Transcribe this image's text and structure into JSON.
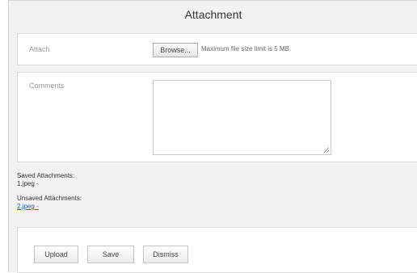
{
  "dialog": {
    "title": "Attachment"
  },
  "attach": {
    "label": "Attach",
    "browse_label": "Browse...",
    "hint": "Maximum file size limit is 5 MB."
  },
  "comments": {
    "label": "Comments",
    "value": ""
  },
  "saved": {
    "heading": "Saved Attachments:",
    "files": [
      "1.jpeg -"
    ]
  },
  "unsaved": {
    "heading": "Unsaved Attachments:",
    "files": [
      "2.jpeg -"
    ]
  },
  "actions": {
    "upload_label": "Upload",
    "save_label": "Save",
    "dismiss_label": "Dismiss"
  }
}
